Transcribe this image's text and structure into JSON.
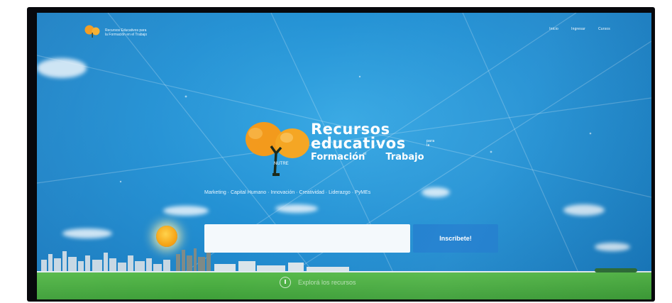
{
  "header": {
    "logo_text": "Recursos Educativos para la Formación en el Trabajo",
    "nav": [
      {
        "label": "Inicio"
      },
      {
        "label": "Ingresar"
      },
      {
        "label": "Cursos"
      }
    ]
  },
  "hero": {
    "title_line1": "Recursos",
    "title_line2": "educativos",
    "title_small_para": "para la",
    "title_line3": "Formación",
    "title_small_el": "el",
    "title_line3_end": "Trabajo",
    "mini_mark": "NUTRE",
    "categories": "Marketing · Capital Humano · Innovación · Creatividad · Liderazgo · PyMEs"
  },
  "signup": {
    "placeholder": "",
    "button_label": "Inscribete!"
  },
  "footer": {
    "scroll_text": "Explorá los recursos"
  },
  "colors": {
    "sky": "#2391d4",
    "button": "#1f7fcf",
    "grass": "#3e9f39",
    "tree": "#f39a1c"
  }
}
